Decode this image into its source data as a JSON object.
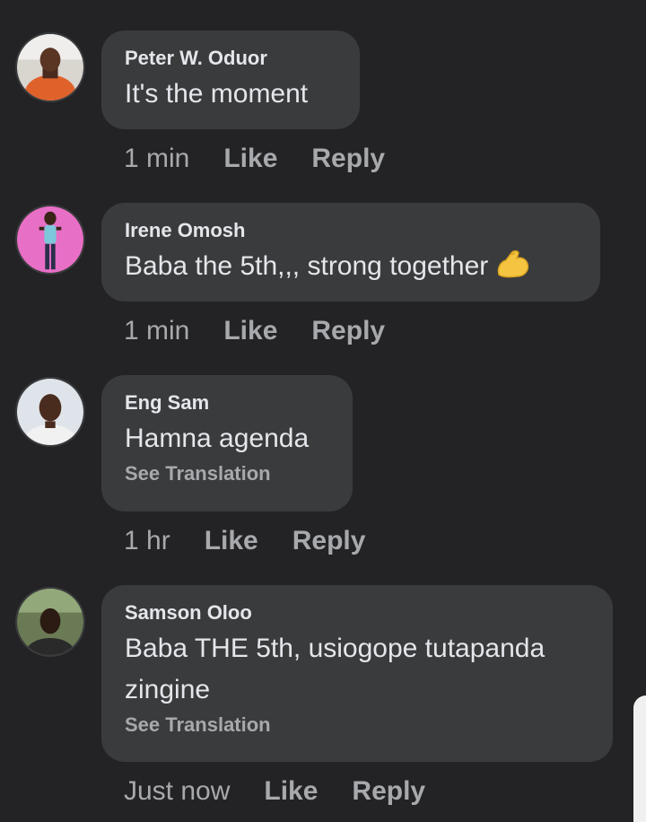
{
  "comments": [
    {
      "author": "Peter W. Oduor",
      "text": "It's the moment",
      "time": "1 min",
      "like": "Like",
      "reply": "Reply"
    },
    {
      "author": "Irene Omosh",
      "text": "Baba the 5th,,, strong together",
      "emoji": "flexed-biceps-icon",
      "time": "1 min",
      "like": "Like",
      "reply": "Reply"
    },
    {
      "author": "Eng Sam",
      "text": "Hamna agenda",
      "translation": "See Translation",
      "time": "1 hr",
      "like": "Like",
      "reply": "Reply"
    },
    {
      "author": "Samson Oloo",
      "text_line1": "Baba THE 5th, usiogope tutapanda",
      "text_line2": "zingine",
      "translation": "See Translation",
      "time": "Just now",
      "like": "Like",
      "reply": "Reply"
    }
  ],
  "colors": {
    "background": "#232325",
    "bubble": "#3a3b3c",
    "primary_text": "#e4e6eb",
    "secondary_text": "#a7a9ad"
  }
}
